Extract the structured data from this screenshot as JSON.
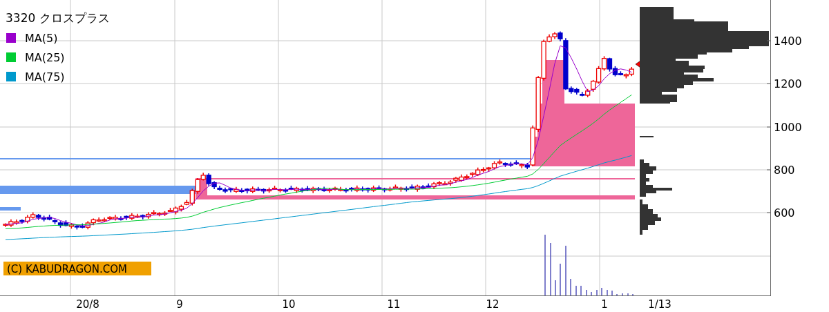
{
  "title": {
    "code": "3320",
    "name": "クロスプラス"
  },
  "legend": [
    {
      "label": "MA(5)",
      "color": "#9900cc"
    },
    {
      "label": "MA(25)",
      "color": "#00cc33"
    },
    {
      "label": "MA(75)",
      "color": "#0099cc"
    }
  ],
  "copyright": "(C) KABUDRAGON.COM",
  "y_axis": [
    "1400",
    "1200",
    "1000",
    "800",
    "600"
  ],
  "x_axis": [
    "20/8",
    "9",
    "10",
    "11",
    "12",
    "1",
    "1/13"
  ]
}
